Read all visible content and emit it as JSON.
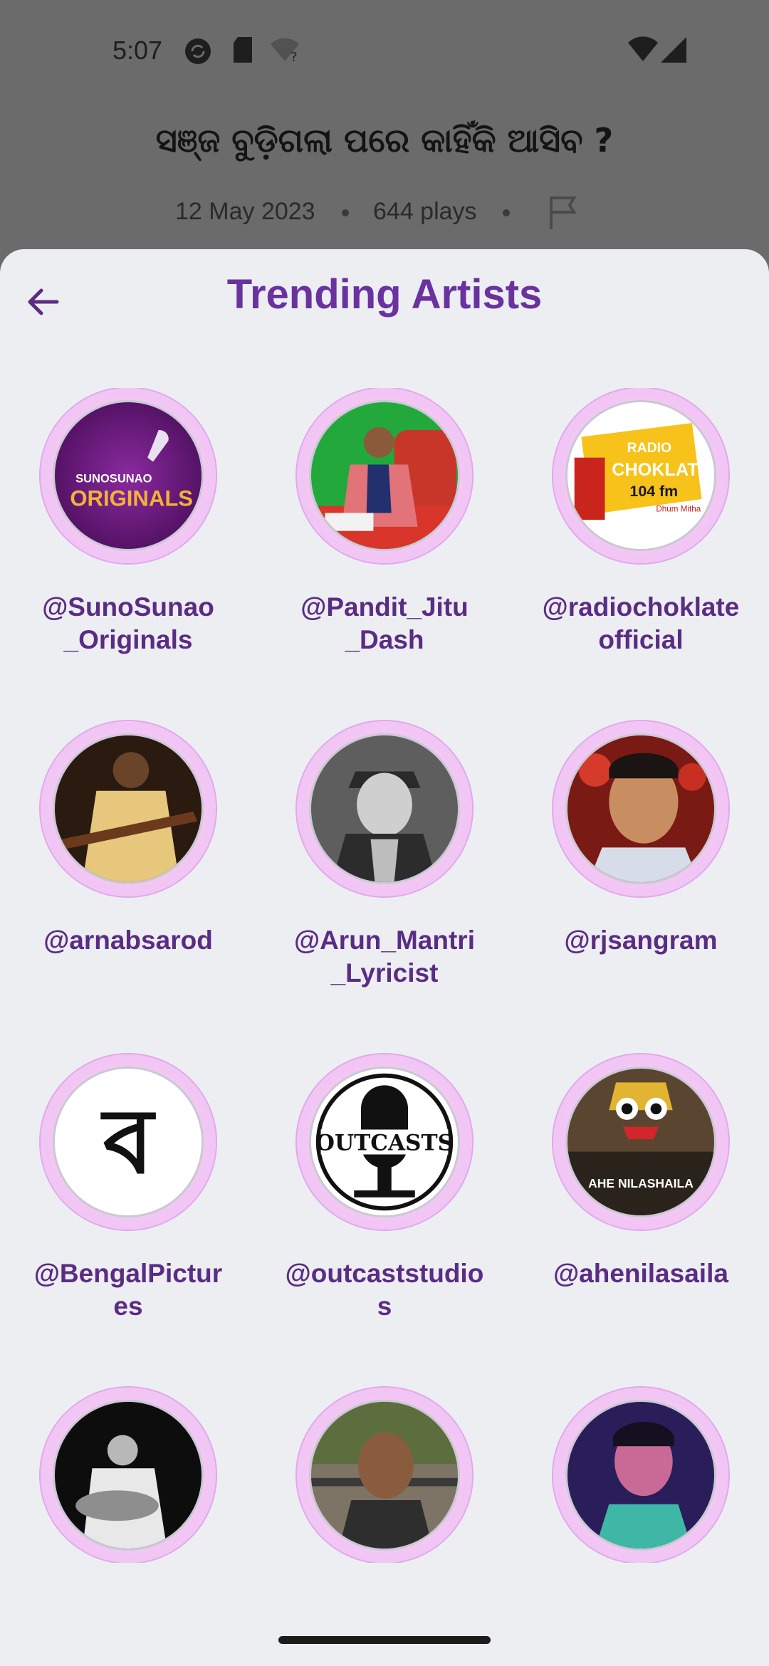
{
  "status_bar": {
    "time": "5:07",
    "icons": [
      "sync-icon",
      "sd-card-icon",
      "wifi-question-icon",
      "wifi-icon",
      "signal-icon"
    ]
  },
  "background": {
    "title": "ସଞ୍ଜ ବୁଡ଼ିଗଲା ପରେ କାହିଁକି ଆସିବ ?",
    "date": "12 May 2023",
    "plays": "644 plays",
    "flag_icon": "flag-icon"
  },
  "sheet": {
    "title": "Trending Artists",
    "back_icon": "arrow-left-icon",
    "artists": [
      {
        "handle": "@SunoSunao\n_Originals",
        "logo_top": "SUNOSUNAO",
        "logo_bottom": "ORIGINALS"
      },
      {
        "handle": "@Pandit_Jitu\n_Dash"
      },
      {
        "handle": "@radiochoklate\nofficial",
        "logo_top": "RADIO",
        "logo_mid": "CHOKLATE",
        "logo_freq": "104 fm",
        "logo_tag": "Dhum Mitha"
      },
      {
        "handle": "@arnabsarod"
      },
      {
        "handle": "@Arun_Mantri\n_Lyricist"
      },
      {
        "handle": "@rjsangram"
      },
      {
        "handle": "@BengalPictur\nes",
        "logo_glyph": "ব"
      },
      {
        "handle": "@outcaststudio\ns",
        "logo_text": "OUTCASTS"
      },
      {
        "handle": "@ahenilasaila",
        "logo_text": "AHE NILASHAILA"
      },
      {
        "handle": ""
      },
      {
        "handle": ""
      },
      {
        "handle": ""
      }
    ]
  },
  "colors": {
    "accent": "#6a329f",
    "sheet_bg": "#eceef2",
    "ring": "#f1c5f4"
  }
}
